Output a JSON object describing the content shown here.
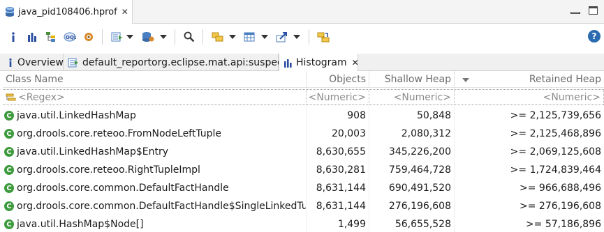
{
  "editor_tab": {
    "title": "java_pid108406.hprof"
  },
  "toolbar": {
    "icons": [
      "info-icon",
      "histogram-icon",
      "dominator-tree-icon",
      "oql-icon",
      "heap-dump-overview-icon",
      "run-report-icon",
      "query-browser-icon",
      "search-icon",
      "find-object-icon",
      "group-by-icon",
      "calculate-retained-icon",
      "export-icon",
      "compare-icon",
      "help-icon"
    ],
    "help_label": "?"
  },
  "tabs": [
    {
      "label": "Overview"
    },
    {
      "label": "default_report",
      "suffix": "org.eclipse.mat.api:suspects"
    },
    {
      "label": "Histogram"
    }
  ],
  "columns": [
    "Class Name",
    "Objects",
    "Shallow Heap",
    "Retained Heap"
  ],
  "filter": {
    "name": "<Regex>",
    "objects": "<Numeric>",
    "shallow": "<Numeric>",
    "retained": "<Numeric>"
  },
  "rows": [
    {
      "name": "java.util.LinkedHashMap",
      "objects": "908",
      "shallow": "50,848",
      "retained": ">= 2,125,739,656"
    },
    {
      "name": "org.drools.core.reteoo.FromNodeLeftTuple",
      "objects": "20,003",
      "shallow": "2,080,312",
      "retained": ">= 2,125,468,896"
    },
    {
      "name": "java.util.LinkedHashMap$Entry",
      "objects": "8,630,655",
      "shallow": "345,226,200",
      "retained": ">= 2,069,125,608"
    },
    {
      "name": "org.drools.core.reteoo.RightTupleImpl",
      "objects": "8,630,281",
      "shallow": "759,464,728",
      "retained": ">= 1,724,839,464"
    },
    {
      "name": "org.drools.core.common.DefaultFactHandle",
      "objects": "8,631,144",
      "shallow": "690,491,520",
      "retained": ">= 966,688,496"
    },
    {
      "name": "org.drools.core.common.DefaultFactHandle$SingleLinkedTuples",
      "objects": "8,631,144",
      "shallow": "276,196,608",
      "retained": ">= 276,196,608"
    },
    {
      "name": "java.util.HashMap$Node[]",
      "objects": "1,499",
      "shallow": "56,655,528",
      "retained": ">= 57,186,896"
    }
  ],
  "colors": {
    "class_icon": "#3d9a3d",
    "accent": "#2b6cb0"
  }
}
